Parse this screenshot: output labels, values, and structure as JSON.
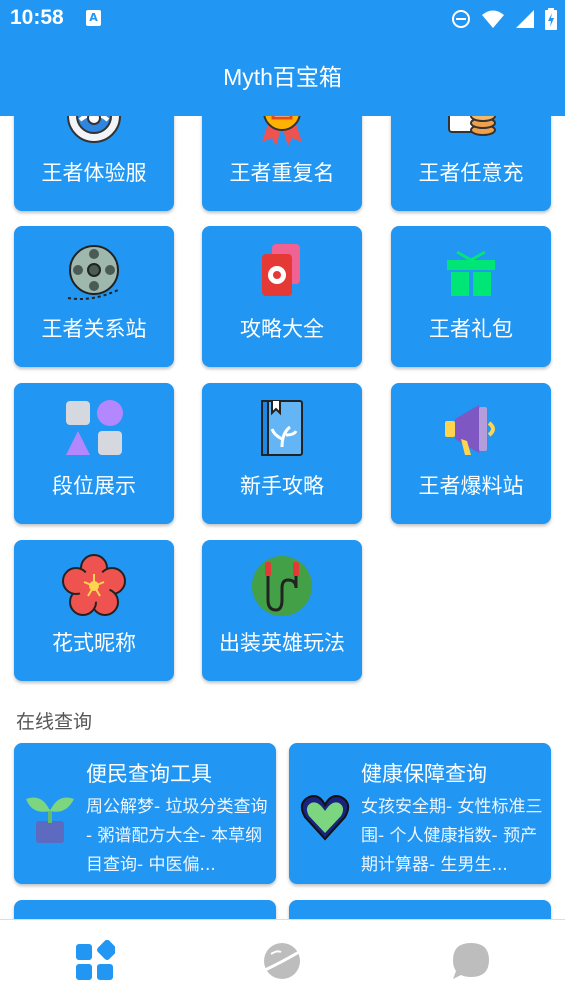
{
  "status_bar": {
    "time": "10:58",
    "notification_badge": "A",
    "icons": [
      "do-not-disturb-icon",
      "wifi-icon",
      "signal-icon",
      "battery-charging-icon"
    ]
  },
  "app_bar": {
    "title": "Myth百宝箱"
  },
  "tools": [
    {
      "label": "王者体验服",
      "icon": "steering-wheel-icon"
    },
    {
      "label": "王者重复名",
      "icon": "medal-icon"
    },
    {
      "label": "王者任意充",
      "icon": "coins-icon"
    },
    {
      "label": "王者关系站",
      "icon": "film-reel-icon"
    },
    {
      "label": "攻略大全",
      "icon": "cards-icon"
    },
    {
      "label": "王者礼包",
      "icon": "gift-icon"
    },
    {
      "label": "段位展示",
      "icon": "shapes-icon"
    },
    {
      "label": "新手攻略",
      "icon": "book-icon"
    },
    {
      "label": "王者爆料站",
      "icon": "megaphone-icon"
    },
    {
      "label": "花式昵称",
      "icon": "flower-icon"
    },
    {
      "label": "出装英雄玩法",
      "icon": "jump-rope-icon"
    }
  ],
  "online_query": {
    "section_title": "在线查询",
    "cards": [
      {
        "title": "便民查询工具",
        "desc": "周公解梦- 垃圾分类查询 - 粥谱配方大全- 本草纲目查询- 中医偏...",
        "icon": "sprout-icon"
      },
      {
        "title": "健康保障查询",
        "desc": "女孩安全期- 女性标准三围- 个人健康指数- 预产期计算器- 生男生...",
        "icon": "heart-icon"
      }
    ]
  },
  "bottom_nav": [
    {
      "name": "home",
      "icon": "grid-apps-icon",
      "active": true
    },
    {
      "name": "discover",
      "icon": "planet-icon",
      "active": false
    },
    {
      "name": "messages",
      "icon": "chat-bubble-icon",
      "active": false
    }
  ],
  "colors": {
    "primary": "#2196f3",
    "nav_inactive": "#bdbdbd",
    "section_text": "#555555"
  }
}
